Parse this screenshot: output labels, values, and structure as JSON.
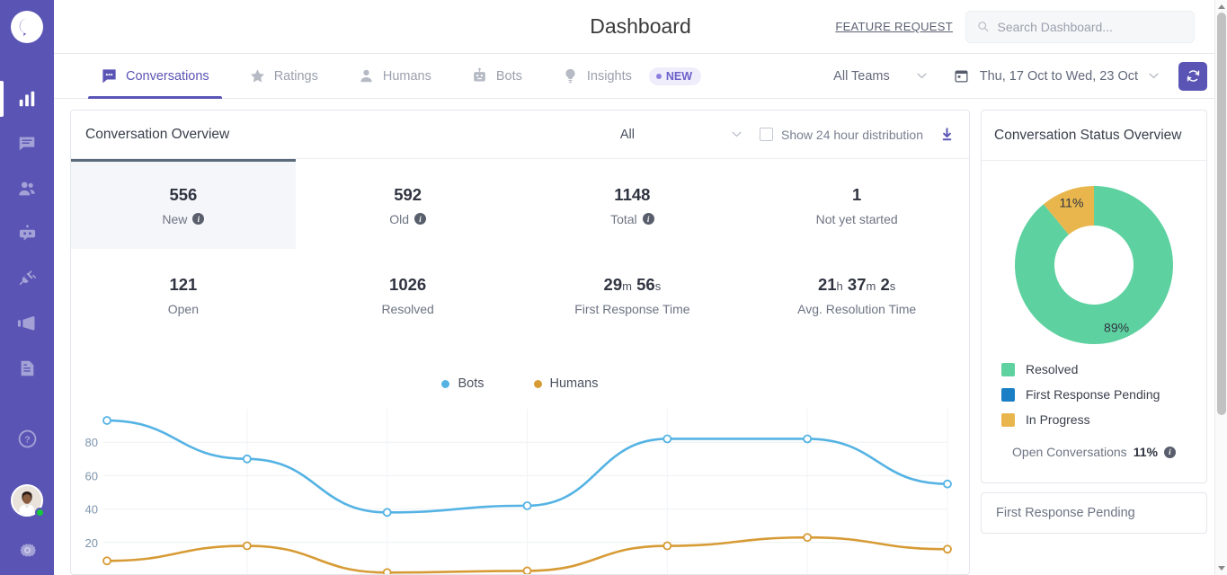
{
  "brand": {
    "icon": "chat-analytics-logo"
  },
  "sidebar": {
    "items": [
      {
        "name": "analytics",
        "icon": "bar-chart-icon",
        "active": true
      },
      {
        "name": "conversations",
        "icon": "chat-icon",
        "active": false
      },
      {
        "name": "humans",
        "icon": "people-icon",
        "active": false
      },
      {
        "name": "bots",
        "icon": "bot-icon",
        "active": false
      },
      {
        "name": "integrations",
        "icon": "plug-icon",
        "active": false
      },
      {
        "name": "campaigns",
        "icon": "megaphone-icon",
        "active": false
      },
      {
        "name": "documents",
        "icon": "document-icon",
        "active": false
      },
      {
        "name": "help",
        "icon": "help-circle-icon",
        "active": false
      }
    ]
  },
  "header": {
    "title": "Dashboard",
    "feature_request": "FEATURE REQUEST",
    "search": {
      "placeholder": "Search Dashboard...",
      "value": ""
    }
  },
  "tabs": [
    {
      "label": "Conversations",
      "icon": "chat-bubble-icon",
      "active": true
    },
    {
      "label": "Ratings",
      "icon": "star-icon",
      "active": false
    },
    {
      "label": "Humans",
      "icon": "person-icon",
      "active": false
    },
    {
      "label": "Bots",
      "icon": "robot-icon",
      "active": false
    },
    {
      "label": "Insights",
      "icon": "lightbulb-icon",
      "active": false,
      "badge": "NEW"
    }
  ],
  "filters": {
    "team": "All Teams",
    "date_range": "Thu, 17 Oct  to  Wed, 23 Oct",
    "refresh": "refresh-icon"
  },
  "overview": {
    "title": "Conversation Overview",
    "channel_filter": "All",
    "checkbox_label": "Show 24 hour distribution",
    "checkbox_checked": false,
    "download": "download-icon",
    "metrics": [
      {
        "value": "556",
        "label": "New",
        "info": true,
        "selected": true
      },
      {
        "value": "592",
        "label": "Old",
        "info": true,
        "selected": false
      },
      {
        "value": "1148",
        "label": "Total",
        "info": true,
        "selected": false
      },
      {
        "value": "1",
        "label": "Not yet started",
        "info": false,
        "selected": false
      },
      {
        "value": "121",
        "label": "Open",
        "info": false,
        "selected": false
      },
      {
        "value": "1026",
        "label": "Resolved",
        "info": false,
        "selected": false
      },
      {
        "value": "29m 56s",
        "label": "First Response Time",
        "info": false,
        "selected": false
      },
      {
        "value": "21h 37m 2s",
        "label": "Avg. Resolution Time",
        "info": false,
        "selected": false
      }
    ]
  },
  "status_overview": {
    "title": "Conversation Status Overview",
    "legend": [
      {
        "label": "Resolved",
        "color": "#5ed1a0"
      },
      {
        "label": "First Response Pending",
        "color": "#1a7fc4"
      },
      {
        "label": "In Progress",
        "color": "#e8b64c"
      }
    ],
    "open_conversations_label": "Open Conversations",
    "open_conversations_value": "11%"
  },
  "bottom_card": {
    "title": "First Response Pending"
  },
  "chart_data": [
    {
      "type": "line",
      "title": "",
      "xlabel": "",
      "ylabel": "",
      "ylim": [
        0,
        100
      ],
      "yticks": [
        20,
        40,
        60,
        80
      ],
      "grid": true,
      "legend_position": "top",
      "x": [
        "1",
        "2",
        "3",
        "4",
        "5",
        "6",
        "7"
      ],
      "series": [
        {
          "name": "Bots",
          "color": "#55b3e4",
          "values": [
            93,
            70,
            38,
            42,
            82,
            82,
            55
          ]
        },
        {
          "name": "Humans",
          "color": "#d79b35",
          "values": [
            9,
            18,
            2,
            3,
            18,
            23,
            16
          ]
        }
      ]
    },
    {
      "type": "pie",
      "title": "Conversation Status Overview",
      "labels": [
        "Resolved",
        "In Progress",
        "First Response Pending"
      ],
      "values": [
        89,
        11,
        0
      ],
      "value_labels": [
        "89%",
        "11%",
        ""
      ],
      "colors": [
        "#5ed1a0",
        "#e8b64c",
        "#1a7fc4"
      ],
      "donut": true,
      "legend_position": "bottom"
    }
  ]
}
